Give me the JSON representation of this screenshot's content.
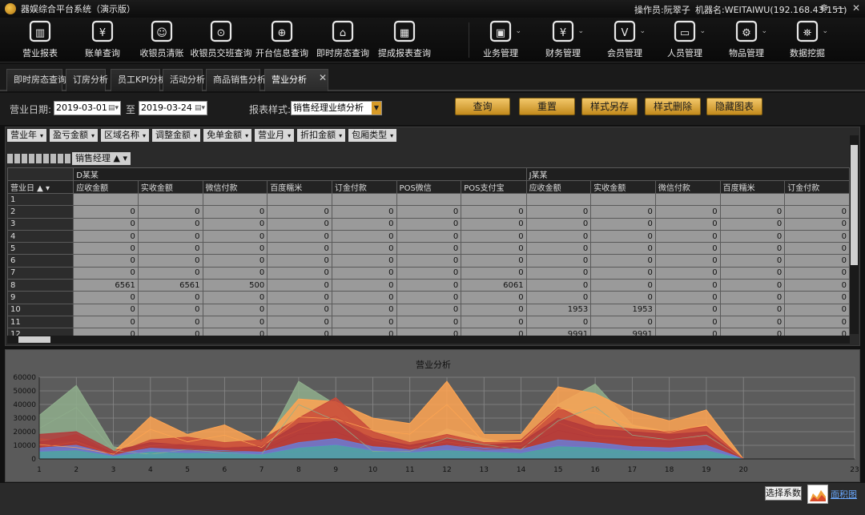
{
  "window": {
    "title": "器娱综合平台系统（演示版）",
    "operator": "操作员:阮翠子",
    "machine": "机器名:WEITAIWU(192.168.43.151)"
  },
  "toolbar": {
    "left": [
      "营业报表",
      "账单查询",
      "收银员清账",
      "收银员交班查询",
      "开台信息查询",
      "即时房态查询",
      "提成报表查询"
    ],
    "right": [
      "业务管理",
      "财务管理",
      "会员管理",
      "人员管理",
      "物品管理",
      "数据挖掘"
    ]
  },
  "tabs": [
    "即时房态查询",
    "订房分析",
    "员工KPI分析",
    "活动分析",
    "商品销售分析",
    "营业分析"
  ],
  "active_tab": "营业分析",
  "filter": {
    "date_label": "营业日期:",
    "date_from": "2019-03-01",
    "to_label": "至",
    "date_to": "2019-03-24",
    "style_label": "报表样式:",
    "style_value": "销售经理业绩分析",
    "buttons": [
      "查询",
      "重置",
      "样式另存",
      "样式删除",
      "隐藏图表"
    ]
  },
  "grid": {
    "column_dims": [
      "营业年",
      "盈亏金额",
      "区域名称",
      "调整金额",
      "免单金额",
      "营业月",
      "折扣金额",
      "包厢类型"
    ],
    "row_dim_header": "销售经理",
    "row_label_header": "营业日",
    "groups": [
      "D某某",
      "J某某"
    ],
    "columns": [
      "应收金额",
      "实收金额",
      "微信付款",
      "百度糯米",
      "订金付款",
      "POS微信",
      "POS支付宝",
      "应收金额",
      "实收金额",
      "微信付款",
      "百度糯米",
      "订金付款"
    ],
    "rows": [
      {
        "day": "1",
        "cells": [
          "",
          "",
          "",
          "",
          "",
          "",
          "",
          "",
          "",
          "",
          "",
          ""
        ]
      },
      {
        "day": "2",
        "cells": [
          "0",
          "0",
          "0",
          "0",
          "0",
          "0",
          "0",
          "0",
          "0",
          "0",
          "0",
          "0"
        ]
      },
      {
        "day": "3",
        "cells": [
          "0",
          "0",
          "0",
          "0",
          "0",
          "0",
          "0",
          "0",
          "0",
          "0",
          "0",
          "0"
        ]
      },
      {
        "day": "4",
        "cells": [
          "0",
          "0",
          "0",
          "0",
          "0",
          "0",
          "0",
          "0",
          "0",
          "0",
          "0",
          "0"
        ]
      },
      {
        "day": "5",
        "cells": [
          "0",
          "0",
          "0",
          "0",
          "0",
          "0",
          "0",
          "0",
          "0",
          "0",
          "0",
          "0"
        ]
      },
      {
        "day": "6",
        "cells": [
          "0",
          "0",
          "0",
          "0",
          "0",
          "0",
          "0",
          "0",
          "0",
          "0",
          "0",
          "0"
        ]
      },
      {
        "day": "7",
        "cells": [
          "0",
          "0",
          "0",
          "0",
          "0",
          "0",
          "0",
          "0",
          "0",
          "0",
          "0",
          "0"
        ]
      },
      {
        "day": "8",
        "cells": [
          "6561",
          "6561",
          "500",
          "0",
          "0",
          "0",
          "6061",
          "0",
          "0",
          "0",
          "0",
          "0"
        ]
      },
      {
        "day": "9",
        "cells": [
          "0",
          "0",
          "0",
          "0",
          "0",
          "0",
          "0",
          "0",
          "0",
          "0",
          "0",
          "0"
        ]
      },
      {
        "day": "10",
        "cells": [
          "0",
          "0",
          "0",
          "0",
          "0",
          "0",
          "0",
          "1953",
          "1953",
          "0",
          "0",
          "0"
        ]
      },
      {
        "day": "11",
        "cells": [
          "0",
          "0",
          "0",
          "0",
          "0",
          "0",
          "0",
          "0",
          "0",
          "0",
          "0",
          "0"
        ]
      },
      {
        "day": "12",
        "cells": [
          "0",
          "0",
          "0",
          "0",
          "0",
          "0",
          "0",
          "9991",
          "9991",
          "0",
          "0",
          "0"
        ]
      }
    ]
  },
  "chart_data": {
    "type": "area",
    "title": "营业分析",
    "x": [
      1,
      2,
      3,
      4,
      5,
      6,
      7,
      8,
      9,
      10,
      11,
      12,
      13,
      14,
      15,
      16,
      17,
      18,
      19,
      20,
      23
    ],
    "xlim": [
      1,
      23
    ],
    "ylim": [
      0,
      60000
    ],
    "yticks": [
      0,
      10000,
      20000,
      30000,
      40000,
      50000,
      60000
    ],
    "grid": true,
    "series": [
      {
        "color": "#8fae8c",
        "values": [
          32000,
          54000,
          9000,
          5000,
          10000,
          6000,
          5000,
          57000,
          40000,
          8000,
          8000,
          22000,
          15000,
          10000,
          40000,
          55000,
          25000,
          20000,
          25000,
          0,
          0
        ]
      },
      {
        "color": "#ffa552",
        "values": [
          15000,
          12000,
          5000,
          31000,
          18000,
          25000,
          12000,
          44000,
          42000,
          30000,
          26000,
          57000,
          18000,
          18000,
          53000,
          48000,
          35000,
          28000,
          36000,
          0,
          0
        ]
      },
      {
        "color": "#c84a3a",
        "values": [
          12000,
          18000,
          4000,
          14000,
          16000,
          12000,
          14000,
          30000,
          45000,
          20000,
          12000,
          18000,
          12000,
          14000,
          38000,
          25000,
          22000,
          20000,
          24000,
          0,
          0
        ]
      },
      {
        "color": "#b23a3a",
        "values": [
          18000,
          20000,
          6000,
          12000,
          10000,
          8000,
          9000,
          26000,
          28000,
          15000,
          10000,
          15000,
          10000,
          12000,
          30000,
          22000,
          20000,
          18000,
          20000,
          0,
          0
        ]
      },
      {
        "color": "#6a7bd6",
        "values": [
          8000,
          10000,
          3000,
          8000,
          7000,
          6000,
          5000,
          12000,
          15000,
          9000,
          7000,
          10000,
          8000,
          7000,
          14000,
          12000,
          9000,
          8000,
          10000,
          0,
          0
        ]
      },
      {
        "color": "#4fa3a3",
        "values": [
          5000,
          6000,
          2000,
          5000,
          4000,
          5000,
          3000,
          8000,
          10000,
          6000,
          5000,
          6000,
          5000,
          4000,
          9000,
          8000,
          6000,
          5000,
          6000,
          0,
          0
        ]
      }
    ]
  },
  "bottom": {
    "select_series": "选择系数",
    "area_link": "面积图"
  }
}
